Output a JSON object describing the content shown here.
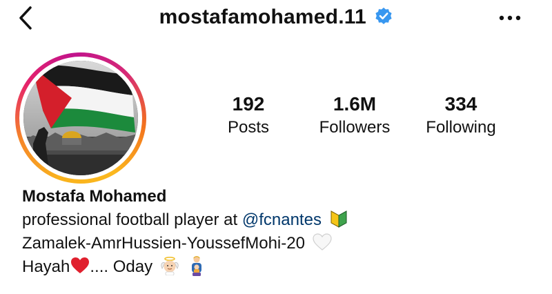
{
  "header": {
    "username": "mostafamohamed.11",
    "verified_icon": "verified-badge-icon",
    "back_icon": "chevron-left-icon",
    "more_icon": "more-horizontal-icon"
  },
  "profile": {
    "avatar_icon": "avatar",
    "stats": [
      {
        "value": "192",
        "label": "Posts"
      },
      {
        "value": "1.6M",
        "label": "Followers"
      },
      {
        "value": "334",
        "label": "Following"
      }
    ]
  },
  "bio": {
    "full_name": "Mostafa Mohamed",
    "line1_text": "professional football player at ",
    "line1_mention": "@fcnantes",
    "line1_emoji": "beginner-symbol-icon",
    "line2_text": "Zamalek-AmrHussien-YoussefMohi-20",
    "line2_emoji": "white-heart-icon",
    "line3_text_a": "Hayah",
    "line3_emoji_a": "red-heart-icon",
    "line3_text_b": ".... Oday",
    "line3_emoji_b": "baby-angel-icon",
    "line3_emoji_c": "family-icon"
  },
  "colors": {
    "verified_blue": "#3897f0",
    "mention_blue": "#00376b",
    "ring_orange": "#f58529",
    "ring_pink": "#dd2a7b"
  }
}
